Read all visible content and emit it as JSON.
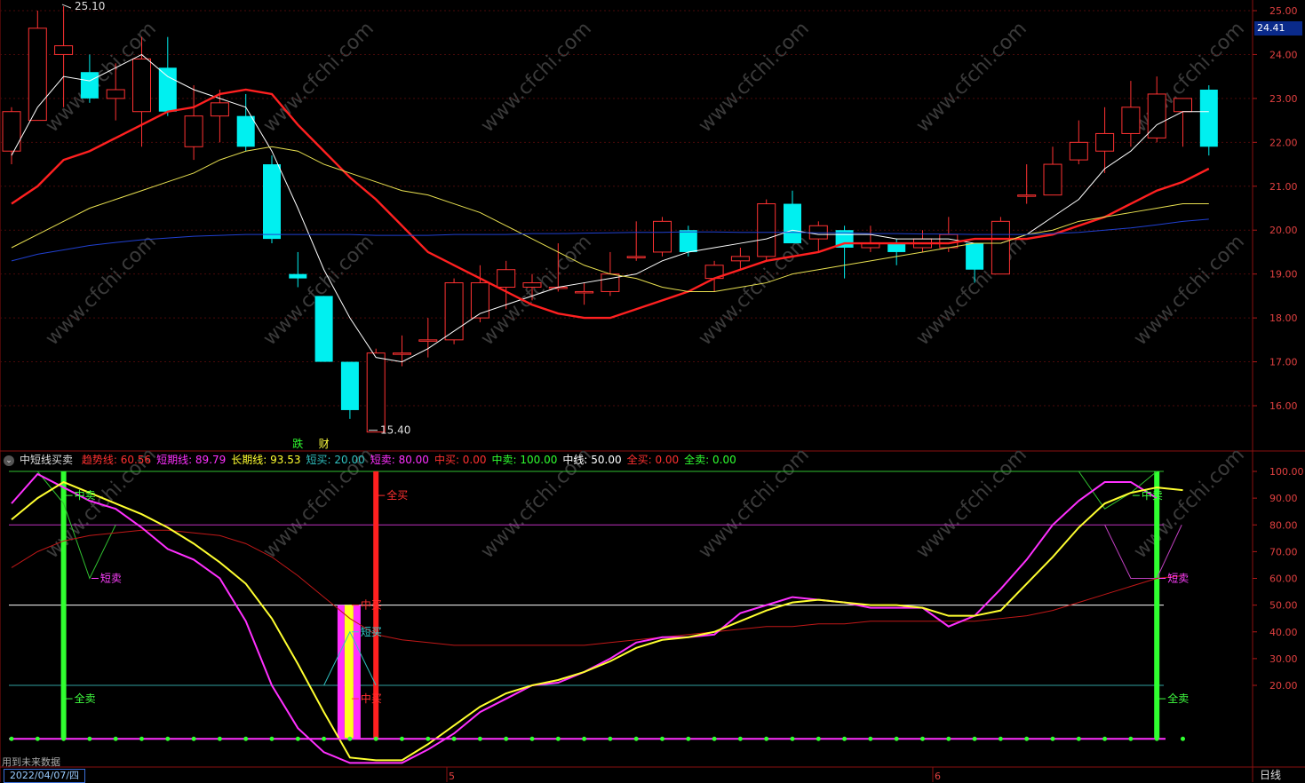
{
  "chart_data": [
    {
      "type": "candlestick",
      "ylim": [
        15.0,
        25.3
      ],
      "y_ticks": [
        "25.00",
        "24.00",
        "23.00",
        "22.00",
        "21.00",
        "20.00",
        "19.00",
        "18.00",
        "17.00",
        "16.00"
      ],
      "current_price_label": "24.41",
      "high_annotation": "25.10",
      "low_annotation": "15.40",
      "signals": [
        {
          "label": "跌",
          "index": 11
        },
        {
          "label": "财",
          "index": 12
        }
      ],
      "candles": [
        {
          "o": 21.8,
          "h": 22.8,
          "l": 21.5,
          "c": 22.7
        },
        {
          "o": 22.5,
          "h": 25.0,
          "l": 22.5,
          "c": 24.6
        },
        {
          "o": 24.0,
          "h": 25.1,
          "l": 22.8,
          "c": 24.2
        },
        {
          "o": 23.6,
          "h": 24.0,
          "l": 22.9,
          "c": 23.0
        },
        {
          "o": 23.0,
          "h": 23.8,
          "l": 22.5,
          "c": 23.2
        },
        {
          "o": 22.7,
          "h": 24.4,
          "l": 21.9,
          "c": 23.9
        },
        {
          "o": 23.7,
          "h": 24.4,
          "l": 22.6,
          "c": 22.7
        },
        {
          "o": 21.9,
          "h": 23.3,
          "l": 21.6,
          "c": 22.6
        },
        {
          "o": 22.6,
          "h": 23.2,
          "l": 22.0,
          "c": 22.9
        },
        {
          "o": 22.6,
          "h": 23.1,
          "l": 21.8,
          "c": 21.9
        },
        {
          "o": 21.5,
          "h": 21.7,
          "l": 19.7,
          "c": 19.8
        },
        {
          "o": 19.0,
          "h": 19.5,
          "l": 18.7,
          "c": 18.9
        },
        {
          "o": 18.5,
          "h": 18.5,
          "l": 17.0,
          "c": 17.0
        },
        {
          "o": 17.0,
          "h": 17.0,
          "l": 15.7,
          "c": 15.9
        },
        {
          "o": 15.4,
          "h": 17.3,
          "l": 15.4,
          "c": 17.2
        },
        {
          "o": 17.2,
          "h": 17.6,
          "l": 16.9,
          "c": 17.2
        },
        {
          "o": 17.5,
          "h": 18.0,
          "l": 17.1,
          "c": 17.5
        },
        {
          "o": 17.5,
          "h": 18.9,
          "l": 17.4,
          "c": 18.8
        },
        {
          "o": 18.0,
          "h": 19.2,
          "l": 17.9,
          "c": 18.8
        },
        {
          "o": 18.7,
          "h": 19.3,
          "l": 18.2,
          "c": 19.1
        },
        {
          "o": 18.7,
          "h": 19.0,
          "l": 18.4,
          "c": 18.8
        },
        {
          "o": 18.7,
          "h": 19.7,
          "l": 18.6,
          "c": 18.7
        },
        {
          "o": 18.6,
          "h": 18.8,
          "l": 18.3,
          "c": 18.6
        },
        {
          "o": 18.6,
          "h": 19.5,
          "l": 18.5,
          "c": 19.0
        },
        {
          "o": 19.4,
          "h": 20.2,
          "l": 19.3,
          "c": 19.4
        },
        {
          "o": 19.5,
          "h": 20.3,
          "l": 19.4,
          "c": 20.2
        },
        {
          "o": 20.0,
          "h": 20.1,
          "l": 19.4,
          "c": 19.5
        },
        {
          "o": 18.9,
          "h": 19.3,
          "l": 18.6,
          "c": 19.2
        },
        {
          "o": 19.3,
          "h": 19.6,
          "l": 19.1,
          "c": 19.4
        },
        {
          "o": 19.4,
          "h": 20.7,
          "l": 19.3,
          "c": 20.6
        },
        {
          "o": 20.6,
          "h": 20.9,
          "l": 19.7,
          "c": 19.7
        },
        {
          "o": 19.8,
          "h": 20.2,
          "l": 19.5,
          "c": 20.1
        },
        {
          "o": 20.0,
          "h": 20.1,
          "l": 18.9,
          "c": 19.6
        },
        {
          "o": 19.6,
          "h": 20.1,
          "l": 19.5,
          "c": 19.7
        },
        {
          "o": 19.7,
          "h": 19.8,
          "l": 19.2,
          "c": 19.5
        },
        {
          "o": 19.6,
          "h": 20.0,
          "l": 19.5,
          "c": 19.8
        },
        {
          "o": 19.6,
          "h": 20.3,
          "l": 19.5,
          "c": 19.9
        },
        {
          "o": 19.7,
          "h": 19.7,
          "l": 18.8,
          "c": 19.1
        },
        {
          "o": 19.0,
          "h": 20.3,
          "l": 19.0,
          "c": 20.2
        },
        {
          "o": 20.8,
          "h": 21.5,
          "l": 20.6,
          "c": 20.8
        },
        {
          "o": 20.8,
          "h": 21.9,
          "l": 20.8,
          "c": 21.5
        },
        {
          "o": 21.6,
          "h": 22.5,
          "l": 21.5,
          "c": 22.0
        },
        {
          "o": 21.8,
          "h": 22.8,
          "l": 21.3,
          "c": 22.2
        },
        {
          "o": 22.2,
          "h": 23.4,
          "l": 21.9,
          "c": 22.8
        },
        {
          "o": 22.1,
          "h": 23.5,
          "l": 22.0,
          "c": 23.1
        },
        {
          "o": 22.7,
          "h": 23.0,
          "l": 21.9,
          "c": 23.0
        },
        {
          "o": 23.2,
          "h": 23.3,
          "l": 21.7,
          "c": 21.9
        }
      ],
      "series": [
        {
          "color": "#ffffff",
          "values": [
            21.7,
            22.8,
            23.5,
            23.4,
            23.7,
            24.0,
            23.5,
            23.2,
            23.0,
            22.8,
            21.8,
            20.5,
            19.1,
            18.0,
            17.1,
            17.0,
            17.3,
            17.7,
            18.1,
            18.3,
            18.5,
            18.7,
            18.8,
            18.9,
            19.0,
            19.3,
            19.5,
            19.6,
            19.7,
            19.8,
            20.0,
            19.9,
            19.9,
            19.9,
            19.8,
            19.8,
            19.8,
            19.7,
            19.7,
            19.9,
            20.3,
            20.7,
            21.4,
            21.8,
            22.4,
            22.7,
            22.7
          ]
        },
        {
          "color": "#ff2020",
          "values": [
            20.6,
            21.0,
            21.6,
            21.8,
            22.1,
            22.4,
            22.7,
            22.8,
            23.1,
            23.2,
            23.1,
            22.4,
            21.8,
            21.2,
            20.7,
            20.1,
            19.5,
            19.2,
            18.9,
            18.6,
            18.3,
            18.1,
            18.0,
            18.0,
            18.2,
            18.4,
            18.6,
            18.9,
            19.1,
            19.3,
            19.4,
            19.5,
            19.7,
            19.7,
            19.7,
            19.7,
            19.7,
            19.8,
            19.8,
            19.8,
            19.9,
            20.1,
            20.3,
            20.6,
            20.9,
            21.1,
            21.4
          ]
        },
        {
          "color": "#e8e050",
          "values": [
            19.6,
            19.9,
            20.2,
            20.5,
            20.7,
            20.9,
            21.1,
            21.3,
            21.6,
            21.8,
            21.9,
            21.8,
            21.5,
            21.3,
            21.1,
            20.9,
            20.8,
            20.6,
            20.4,
            20.1,
            19.8,
            19.5,
            19.2,
            19.0,
            18.9,
            18.7,
            18.6,
            18.6,
            18.7,
            18.8,
            19.0,
            19.1,
            19.2,
            19.3,
            19.4,
            19.5,
            19.6,
            19.7,
            19.7,
            19.9,
            20.0,
            20.2,
            20.3,
            20.4,
            20.5,
            20.6,
            20.6
          ]
        },
        {
          "color": "#2040d0",
          "values": [
            19.3,
            19.45,
            19.55,
            19.65,
            19.72,
            19.78,
            19.82,
            19.86,
            19.88,
            19.9,
            19.9,
            19.9,
            19.9,
            19.9,
            19.88,
            19.88,
            19.88,
            19.9,
            19.9,
            19.9,
            19.92,
            19.92,
            19.93,
            19.94,
            19.95,
            19.95,
            19.96,
            19.96,
            19.95,
            19.95,
            19.95,
            19.94,
            19.94,
            19.92,
            19.92,
            19.91,
            19.91,
            19.9,
            19.9,
            19.9,
            19.92,
            19.95,
            20.0,
            20.05,
            20.12,
            20.2,
            20.25
          ]
        }
      ]
    },
    {
      "type": "line",
      "title": "中短线买卖",
      "ylim": [
        0,
        100
      ],
      "y_ticks": [
        "100.00",
        "90.00",
        "80.00",
        "70.00",
        "60.00",
        "50.00",
        "40.00",
        "30.00",
        "20.00"
      ],
      "legend": [
        {
          "label": "趋势线: 60.56",
          "color": "#ff3030"
        },
        {
          "label": "短期线: 89.79",
          "color": "#ff30ff"
        },
        {
          "label": "长期线: 93.53",
          "color": "#ffff30"
        },
        {
          "label": "短买: 20.00",
          "color": "#30c0c0"
        },
        {
          "label": "短卖: 80.00",
          "color": "#ff30ff"
        },
        {
          "label": "中买: 0.00",
          "color": "#ff3030"
        },
        {
          "label": "中卖: 100.00",
          "color": "#30ff30"
        },
        {
          "label": "中线: 50.00",
          "color": "#ffffff"
        },
        {
          "label": "全买: 0.00",
          "color": "#ff3030"
        },
        {
          "label": "全卖: 0.00",
          "color": "#30ff30"
        }
      ],
      "reference_lines": [
        {
          "value": 100,
          "color": "#30c030"
        },
        {
          "value": 80,
          "color": "#c030c0"
        },
        {
          "value": 50,
          "color": "#ffffff"
        },
        {
          "value": 20,
          "color": "#30a0a0"
        }
      ],
      "series": [
        {
          "name": "趋势线",
          "color": "#c01818",
          "values": [
            64,
            70,
            74,
            76,
            77,
            78,
            78,
            77,
            76,
            73,
            68,
            61,
            53,
            45,
            39,
            37,
            36,
            35,
            35,
            35,
            35,
            35,
            35,
            36,
            37,
            38,
            39,
            40,
            41,
            42,
            42,
            43,
            43,
            44,
            44,
            44,
            44,
            44,
            45,
            46,
            48,
            51,
            54,
            57,
            60,
            61
          ]
        },
        {
          "name": "短期线",
          "color": "#ff30ff",
          "values": [
            88,
            99,
            94,
            89,
            86,
            79,
            71,
            67,
            60,
            44,
            20,
            4,
            -5,
            -9,
            -9,
            -9,
            -4,
            2,
            10,
            15,
            20,
            21,
            25,
            30,
            36,
            38,
            38,
            39,
            47,
            50,
            53,
            52,
            51,
            49,
            49,
            49,
            42,
            46,
            56,
            67,
            80,
            89,
            96,
            96,
            90
          ]
        },
        {
          "name": "长期线",
          "color": "#ffff30",
          "values": [
            82,
            90,
            96,
            92,
            88,
            84,
            79,
            73,
            66,
            58,
            45,
            28,
            10,
            -7,
            -8,
            -8,
            -2,
            5,
            12,
            17,
            20,
            22,
            25,
            29,
            34,
            37,
            38,
            40,
            44,
            48,
            51,
            52,
            51,
            50,
            50,
            49,
            46,
            46,
            48,
            58,
            68,
            79,
            88,
            92,
            94,
            93
          ]
        }
      ],
      "short_sell_line": {
        "name": "短卖",
        "color": "#c040c0",
        "values": [
          100,
          100,
          60,
          80,
          80,
          80,
          80,
          80,
          80,
          80,
          80,
          80,
          80,
          80,
          80,
          80,
          80,
          80,
          80,
          80,
          80,
          80,
          80,
          80,
          80,
          80,
          80,
          80,
          80,
          80,
          80,
          80,
          80,
          80,
          80,
          80,
          80,
          80,
          80,
          80,
          80,
          80,
          60,
          80
        ]
      },
      "annotations": [
        {
          "text": "中卖",
          "color": "#40ff40",
          "index": 2,
          "value": 91
        },
        {
          "text": "短卖",
          "color": "#ff40ff",
          "index": 3,
          "value": 60
        },
        {
          "text": "全卖",
          "color": "#40ff40",
          "index": 2,
          "value": 15
        },
        {
          "text": "全买",
          "color": "#ff3030",
          "index": 14,
          "value": 91
        },
        {
          "text": "短买",
          "color": "#30d0d0",
          "index": 13,
          "value": 40
        },
        {
          "text": "中买",
          "color": "#ff3030",
          "index": 13,
          "value": 50
        },
        {
          "text": "中买",
          "color": "#ff3030",
          "index": 13,
          "value": 15
        },
        {
          "text": "中卖",
          "color": "#40ff40",
          "index": 43,
          "value": 91
        },
        {
          "text": "短卖",
          "color": "#ff40ff",
          "index": 44,
          "value": 60
        },
        {
          "text": "全卖",
          "color": "#40ff40",
          "index": 44,
          "value": 15
        }
      ],
      "signal_bars": [
        {
          "index": 2,
          "color": "#30ff30",
          "from": 0,
          "to": 100
        },
        {
          "index": 13,
          "color": "#ffff20",
          "from": 0,
          "to": 50
        },
        {
          "index": 14,
          "color": "#ff2020",
          "from": 0,
          "to": 100
        },
        {
          "index": 44,
          "color": "#30ff30",
          "from": 0,
          "to": 100
        }
      ]
    }
  ],
  "footer": {
    "future_note": "用到未来数据",
    "date": "2022/04/07/四",
    "x_ticks": [
      "5",
      "6"
    ],
    "period": "日线"
  },
  "watermark": "www.cfchi.com"
}
